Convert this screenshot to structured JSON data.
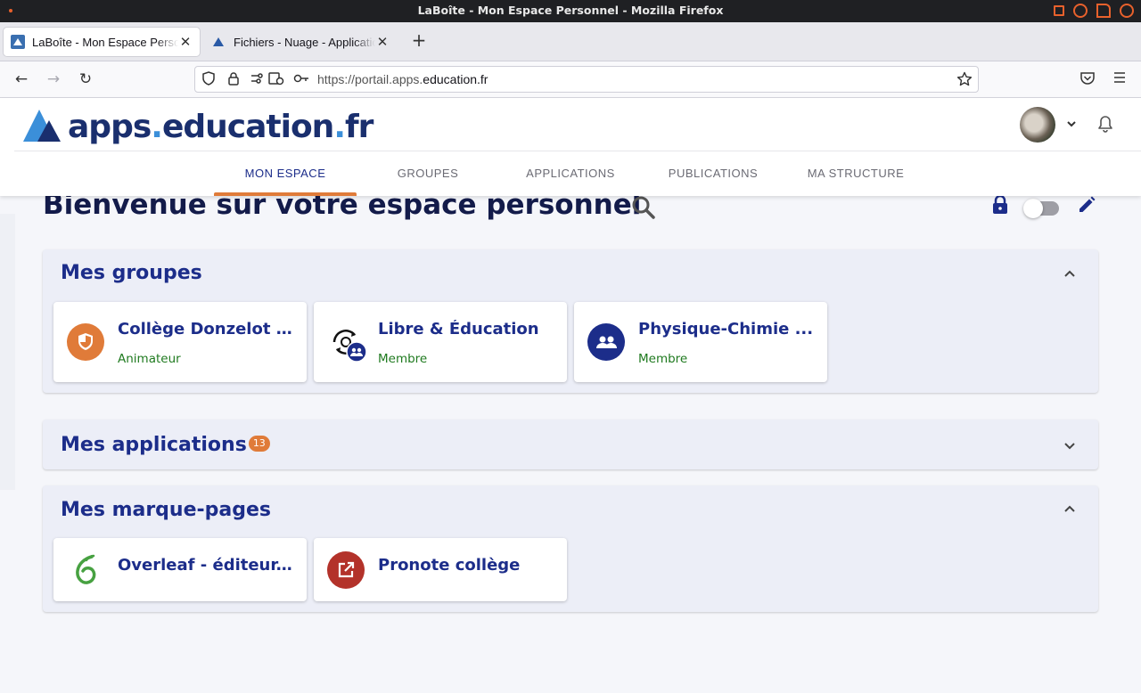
{
  "window": {
    "title": "LaBoîte - Mon Espace Personnel - Mozilla Firefox"
  },
  "tabs": [
    {
      "label": "LaBoîte - Mon Espace Personnel",
      "active": true
    },
    {
      "label": "Fichiers - Nuage - Applications",
      "active": false
    }
  ],
  "urlbar": {
    "prefix": "https://portail.apps.",
    "domain": "education.fr"
  },
  "site": {
    "logo_a": "apps",
    "logo_dot1": ".",
    "logo_b": "education",
    "logo_dot2": ".",
    "logo_c": "fr",
    "nav": [
      "MON ESPACE",
      "GROUPES",
      "APPLICATIONS",
      "PUBLICATIONS",
      "MA STRUCTURE"
    ],
    "nav_active": "MON ESPACE"
  },
  "page": {
    "title": "Bienvenue sur votre espace personnel"
  },
  "groups": {
    "title": "Mes groupes",
    "cards": [
      {
        "title": "Collège Donzelot ...",
        "role": "Animateur",
        "icon": "shield-icon",
        "color": "#e07b39"
      },
      {
        "title": "Libre & Éducation",
        "role": "Membre",
        "icon": "sync-icon",
        "color": "#1c2d8a"
      },
      {
        "title": "Physique-Chimie ...",
        "role": "Membre",
        "icon": "people-icon",
        "color": "#1c2d8a"
      }
    ]
  },
  "applications": {
    "title": "Mes applications",
    "count": "13"
  },
  "bookmarks": {
    "title": "Mes marque-pages",
    "cards": [
      {
        "title": "Overleaf - éditeur...",
        "icon": "overleaf-icon",
        "color": "#47a141"
      },
      {
        "title": "Pronote collège",
        "icon": "external-link-icon",
        "color": "#b3322a"
      }
    ]
  },
  "colors": {
    "accent": "#e07b39",
    "primary": "#1c2d8a",
    "role_green": "#1f7a1f"
  }
}
